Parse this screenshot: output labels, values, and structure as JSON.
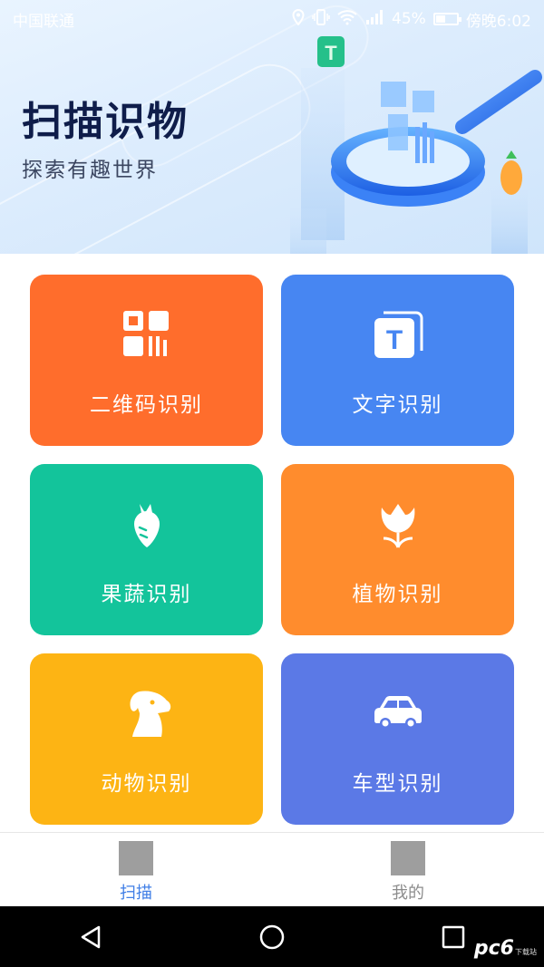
{
  "status_bar": {
    "carrier": "中国联通",
    "battery": "45%",
    "battery_level": 0.45,
    "time": "傍晚6:02",
    "icons": [
      "location-icon",
      "vibrate-icon",
      "wifi-icon",
      "signal-icon",
      "battery-icon"
    ]
  },
  "header": {
    "title": "扫描识物",
    "subtitle": "探索有趣世界",
    "hero_icons": [
      "magnifier-illustration",
      "qr-code-illustration",
      "text-t-badge",
      "carrot-badge"
    ]
  },
  "tiles": [
    {
      "label": "二维码识别",
      "icon": "qr-code-icon",
      "color": "#ff6d2c"
    },
    {
      "label": "文字识别",
      "icon": "text-recognition-icon",
      "color": "#4786f2"
    },
    {
      "label": "果蔬识别",
      "icon": "carrot-icon",
      "color": "#13c49b"
    },
    {
      "label": "植物识别",
      "icon": "tulip-icon",
      "color": "#ff8c2d"
    },
    {
      "label": "动物识别",
      "icon": "dog-icon",
      "color": "#fdb414"
    },
    {
      "label": "车型识别",
      "icon": "car-icon",
      "color": "#5b79e6"
    }
  ],
  "tabbar": {
    "tabs": [
      {
        "label": "扫描",
        "active": true,
        "color": "#3f7ee6"
      },
      {
        "label": "我的",
        "active": false,
        "color": "#8c8c8c"
      }
    ]
  },
  "navbar": {
    "buttons": [
      "back-icon",
      "home-icon",
      "recents-icon"
    ]
  },
  "watermark": {
    "main": "pc6",
    "sub": "下载站"
  },
  "colors": {
    "header_title": "#0f1d4a",
    "banner_bg": "#dcecfd",
    "accent": "#3f7ee6"
  }
}
